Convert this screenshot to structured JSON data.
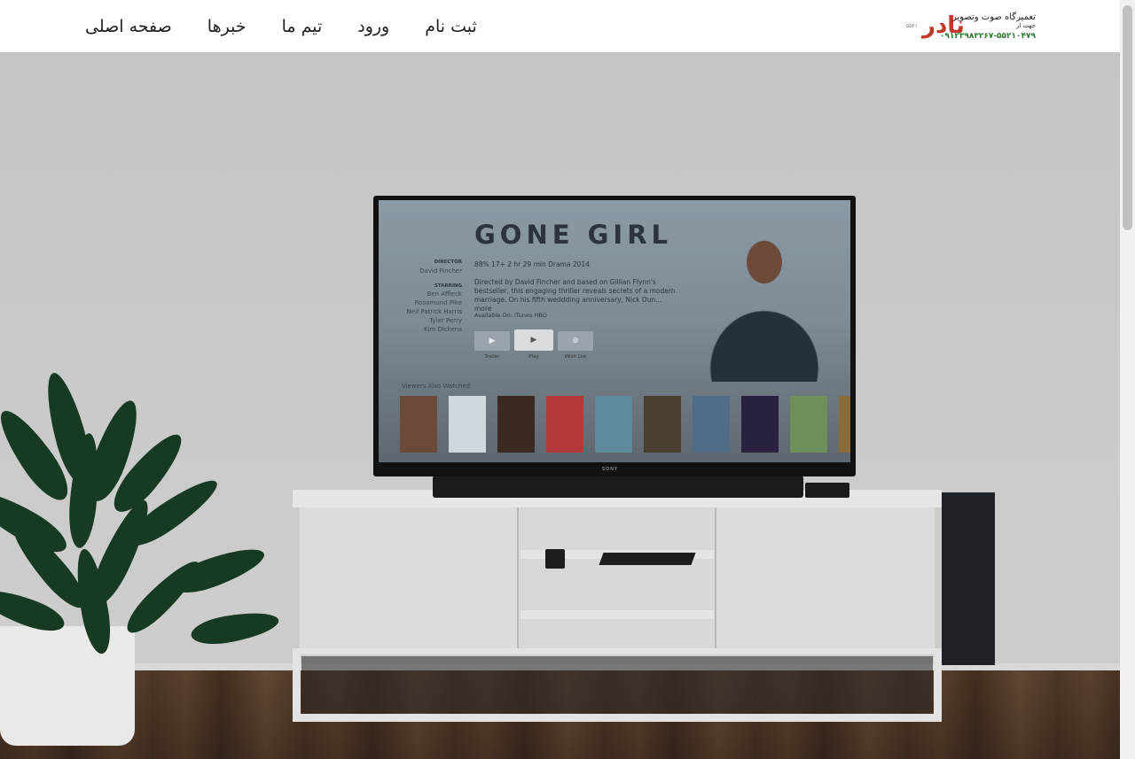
{
  "header": {
    "logo": {
      "line1": "تعمیرگاه صوت وتصویر",
      "line2": "جهت از",
      "name": "نادر",
      "phone": "۰۹۱۲۳۹۸۳۲۶۷-۵۵۲۱۰۴۷۹",
      "tiny": "۵۵۲۱"
    },
    "nav": [
      {
        "label": "صفحه اصلی"
      },
      {
        "label": "خبرها"
      },
      {
        "label": "تیم ما"
      },
      {
        "label": "ورود"
      },
      {
        "label": "ثبت نام"
      }
    ]
  },
  "hero": {
    "tv_screen": {
      "title": "GONE GIRL",
      "meta": "88%   17+   2 hr 29 min   Drama   2014",
      "description": "Directed by David Fincher and based on Gillian Flynn's bestseller, this engaging thriller reveals secrets of a modern marriage. On his fifth weddding anniversary, Nick Dun... more",
      "available": "Available On:   iTunes   HBO",
      "credits": {
        "director_heading": "DIRECTOR",
        "director": "David Fincher",
        "starring_heading": "STARRING",
        "cast": [
          "Ben Affleck",
          "Rosamund Pike",
          "Neil Patrick Harris",
          "Tyler Perry",
          "Kim Dickens"
        ]
      },
      "buttons": [
        "Trailer",
        "Play",
        "Wish List"
      ],
      "viewers_heading": "Viewers Also Watched",
      "posters": [
        {
          "color": "#6b4a3a"
        },
        {
          "color": "#cfd8dc"
        },
        {
          "color": "#3b2a22"
        },
        {
          "color": "#b23a3a"
        },
        {
          "color": "#5c8a9c"
        },
        {
          "color": "#4a4032"
        },
        {
          "color": "#4f6d86"
        },
        {
          "color": "#2a2140"
        },
        {
          "color": "#6f8f5a"
        },
        {
          "color": "#8a6b3a"
        }
      ]
    },
    "tv_brand": "SONY"
  }
}
